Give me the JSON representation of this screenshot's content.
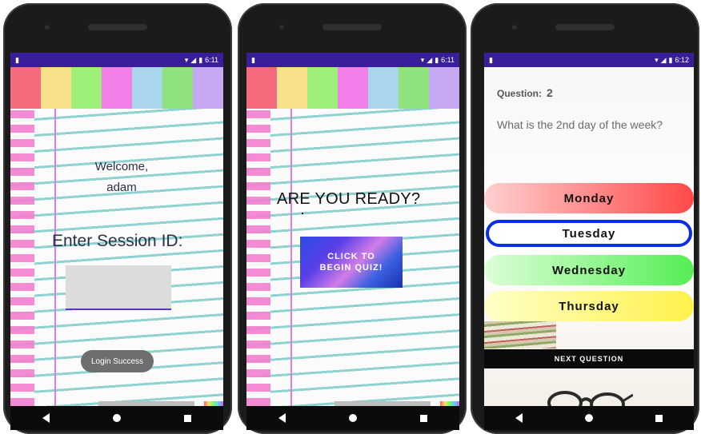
{
  "phone1": {
    "status_time": "6:11",
    "welcome_line1": "Welcome,",
    "welcome_line2": "adam",
    "session_label": "Enter Session ID:",
    "session_value": "",
    "toast": "Login Success"
  },
  "phone2": {
    "status_time": "6:11",
    "title": "ARE YOU READY?",
    "begin_line1": "CLICK TO",
    "begin_line2": "BEGIN QUIZ!"
  },
  "phone3": {
    "status_time": "6:12",
    "question_label": "Question:",
    "question_number": "2",
    "question_text": "What is the 2nd day of the week?",
    "options": [
      {
        "label": "Monday"
      },
      {
        "label": "Tuesday"
      },
      {
        "label": "Wednesday"
      },
      {
        "label": "Thursday"
      }
    ],
    "selected_option": "Tuesday",
    "next_label": "NEXT QUESTION"
  },
  "colors": {
    "status_bar": "#3a1d9a",
    "tabs": [
      "#f56b7d",
      "#f9e08a",
      "#9ff07a",
      "#f37fe8",
      "#a9d6ec",
      "#8fe27c",
      "#c7a8f2"
    ],
    "selected_border": "#0a2ee6"
  }
}
